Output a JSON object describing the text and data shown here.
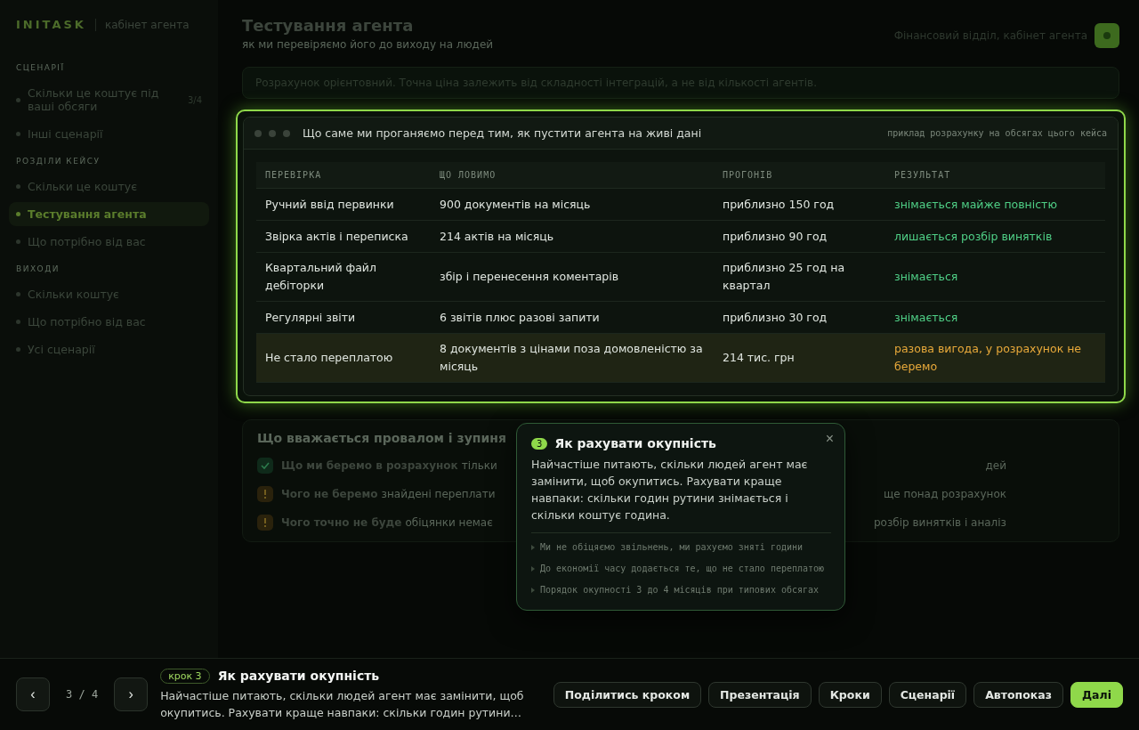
{
  "sidebar": {
    "logo": "INITASK",
    "subtitle": "кабінет агента",
    "sections": [
      {
        "title": "СЦЕНАРІЇ",
        "items": [
          {
            "label": "Скільки це коштує під ваші обсяги",
            "count": "3/4",
            "selected": false
          },
          {
            "label": "Інші сценарії",
            "selected": false
          }
        ]
      },
      {
        "title": "РОЗДІЛИ КЕЙСУ",
        "items": [
          {
            "label": "Скільки це коштує",
            "selected": false
          },
          {
            "label": "Тестування агента",
            "selected": true
          },
          {
            "label": "Що потрібно від вас",
            "selected": false
          }
        ]
      },
      {
        "title": "ВИХОДИ",
        "items": [
          {
            "label": "Скільки коштує",
            "selected": false
          },
          {
            "label": "Що потрібно від вас",
            "selected": false
          },
          {
            "label": "Усі сценарії",
            "selected": false
          }
        ]
      }
    ]
  },
  "header": {
    "title": "Тестування агента",
    "subtitle": "як ми перевіряємо його до виходу на людей",
    "context": "Фінансовий відділ, кабінет агента"
  },
  "notice": "Розрахунок орієнтовний. Точна ціна залежить від складності інтеграцій, а не від кількості агентів.",
  "card": {
    "title": "Що саме ми проганяємо перед тим, як пустити агента на живі дані",
    "note": "приклад розрахунку на обсягах цього кейса",
    "columns": [
      "ПЕРЕВІРКА",
      "ЩО ЛОВИМО",
      "ПРОГОНІВ",
      "РЕЗУЛЬТАТ"
    ],
    "rows": [
      {
        "cells": [
          "Ручний ввід первинки",
          "900 документів на місяць",
          "приблизно 150 год",
          "знімається майже повністю"
        ],
        "color": "#4fcf86",
        "highlighted": false
      },
      {
        "cells": [
          "Звірка актів і переписка",
          "214 актів на місяць",
          "приблизно 90 год",
          "лишається розбір винятків"
        ],
        "color": "#4fcf86",
        "highlighted": false
      },
      {
        "cells": [
          "Квартальний файл дебіторки",
          "збір і перенесення коментарів",
          "приблизно 25 год на квартал",
          "знімається"
        ],
        "color": "#4fcf86",
        "highlighted": false
      },
      {
        "cells": [
          "Регулярні звіти",
          "6 звітів плюс разові запити",
          "приблизно 30 год",
          "знімається"
        ],
        "color": "#4fcf86",
        "highlighted": false
      },
      {
        "cells": [
          "Не стало переплатою",
          "8 документів з цінами поза домовленістю за місяць",
          "214 тис. грн",
          "разова вигода, у розрахунок не беремо"
        ],
        "color": "#e8a93a",
        "highlighted": true
      }
    ]
  },
  "failures": {
    "title": "Що вважається провалом і зупиня",
    "rows": [
      {
        "kind": "ok",
        "label": "Що ми беремо в розрахунок",
        "left": "тільки",
        "right": "дей"
      },
      {
        "kind": "warn",
        "label": "Чого не беремо",
        "left": "знайдені переплати",
        "right": "ще понад розрахунок"
      },
      {
        "kind": "warn",
        "label": "Чого точно не буде",
        "left": "обіцянки немає",
        "right": "розбір винятків і аналіз"
      }
    ]
  },
  "tooltip": {
    "step": "3",
    "title": "Як рахувати окупність",
    "text": "Найчастіше питають, скільки людей агент має замінити, щоб окупитись. Рахувати краще навпаки: скільки годин рутини знімається і скільки коштує година.",
    "close": "×",
    "points": [
      "Ми не обіцяємо звільнень, ми рахуємо зняті години",
      "До економії часу додається те, що не стало переплатою",
      "Порядок окупності 3 до 4 місяців при типових обсягах"
    ]
  },
  "footer": {
    "prev": "‹",
    "next": "›",
    "position": "3 / 4",
    "badge": "крок 3",
    "title": "Як рахувати окупність",
    "text": "Найчастіше питають, скільки людей агент має замінити, щоб окупитись. Рахувати краще навпаки: скільки годин рутини…",
    "buttons": [
      {
        "label": "Поділитись кроком",
        "kind": "default"
      },
      {
        "label": "Презентація",
        "kind": "default"
      },
      {
        "label": "Кроки",
        "kind": "default"
      },
      {
        "label": "Сценарії",
        "kind": "default"
      },
      {
        "label": "Автопоказ",
        "kind": "default"
      },
      {
        "label": "Далі",
        "kind": "primary"
      }
    ]
  }
}
